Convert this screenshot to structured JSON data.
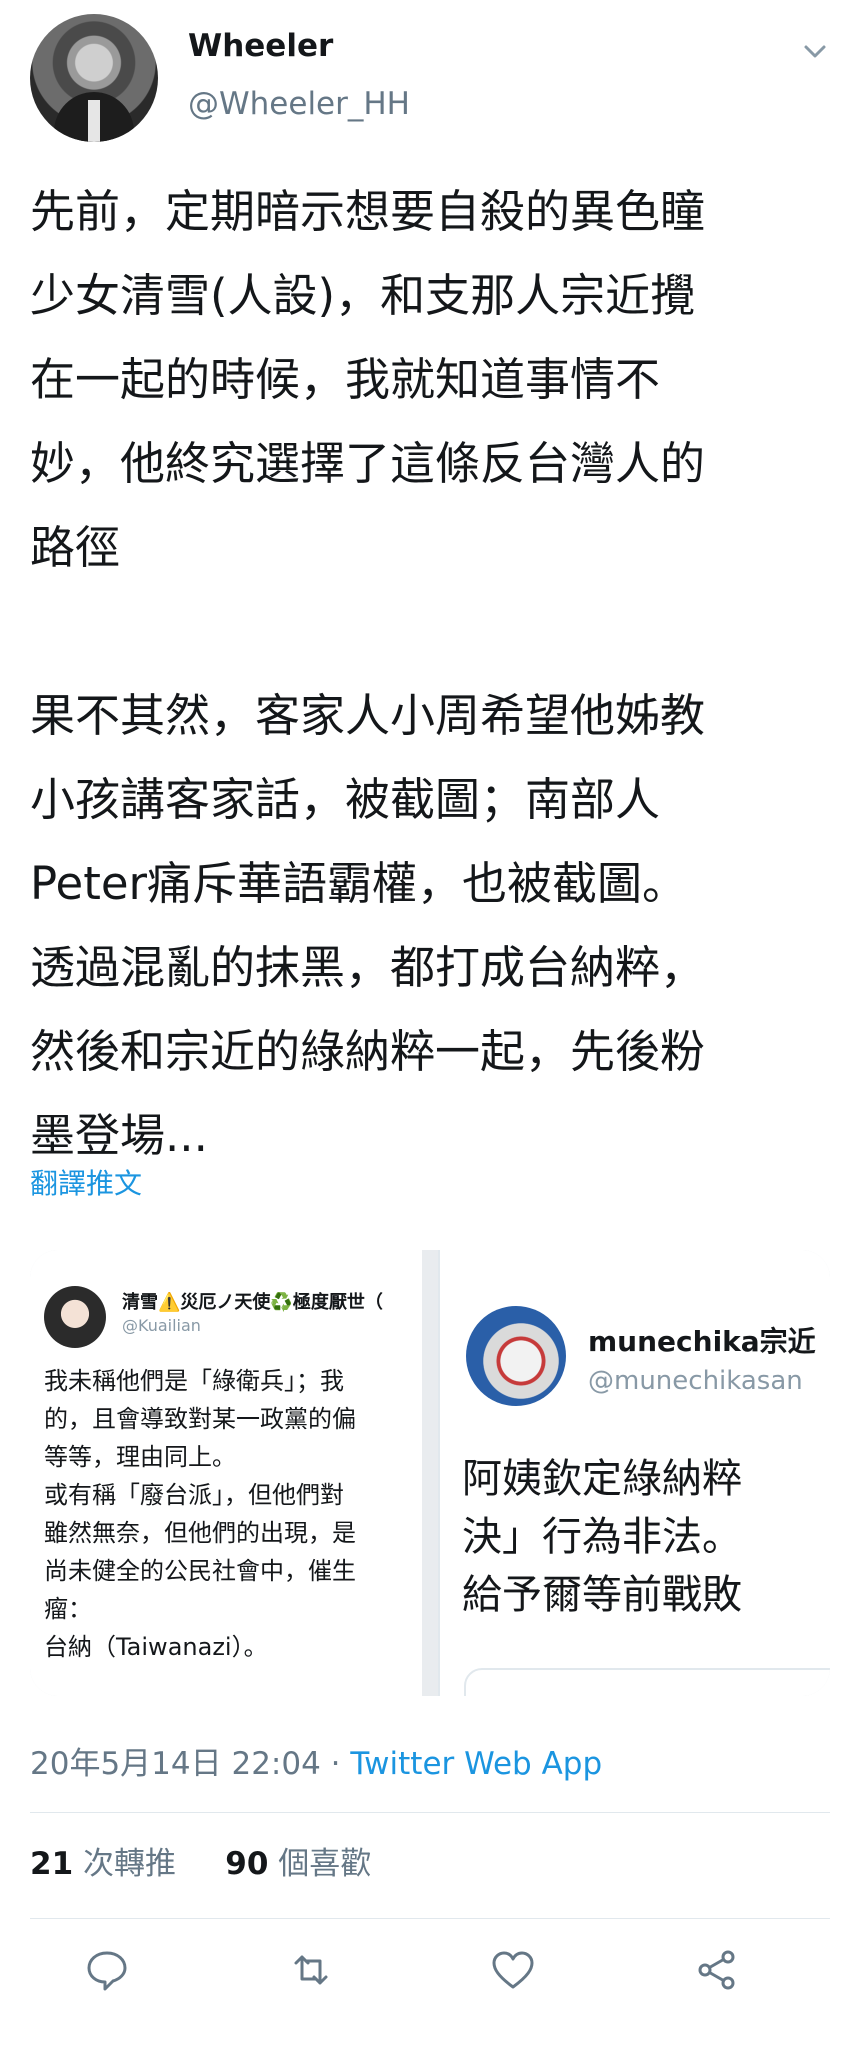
{
  "author": {
    "display_name": "Wheeler",
    "handle": "@Wheeler_HH",
    "avatar_icon": "profile-photo"
  },
  "tweet": {
    "text": "先前，定期暗示想要自殺的異色瞳\n少女清雪(人設)，和支那人宗近攪\n在一起的時候，我就知道事情不\n妙，他終究選擇了這條反台灣人的\n路徑\n\n果不其然，客家人小周希望他姊教\n小孩講客家話，被截圖；南部人\nPeter痛斥華語霸權，也被截圖。\n透過混亂的抹黑，都打成台納粹，\n然後和宗近的綠納粹一起，先後粉\n墨登場...",
    "translate_label": "翻譯推文"
  },
  "media": {
    "left_card": {
      "name": "清雪⚠️災厄ノ天使♻️極度厭世（",
      "handle": "@Kuailian",
      "body": "我未稱他們是「綠衛兵」；我\n的，且會導致對某一政黨的偏\n等等，理由同上。\n或有稱「廢台派」，但他們對\n雖然無奈，但他們的出現，是\n尚未健全的公民社會中，催生\n瘤：\n台納（Taiwanazi）。"
    },
    "right_card": {
      "name": "munechika宗近",
      "handle": "@munechikasan",
      "body": "阿姨欽定綠納粹\n決」行為非法。\n給予爾等前戰敗"
    }
  },
  "meta": {
    "timestamp": "20年5月14日 22:04",
    "separator": " · ",
    "source": "Twitter Web App"
  },
  "stats": {
    "retweets_count": "21",
    "retweets_label": "次轉推",
    "likes_count": "90",
    "likes_label": "個喜歡"
  },
  "actions": [
    "reply-icon",
    "retweet-icon",
    "like-icon",
    "share-icon"
  ],
  "colors": {
    "text": "#14171a",
    "secondary": "#657786",
    "link": "#1b95e0",
    "divider": "#e1e8ed"
  }
}
